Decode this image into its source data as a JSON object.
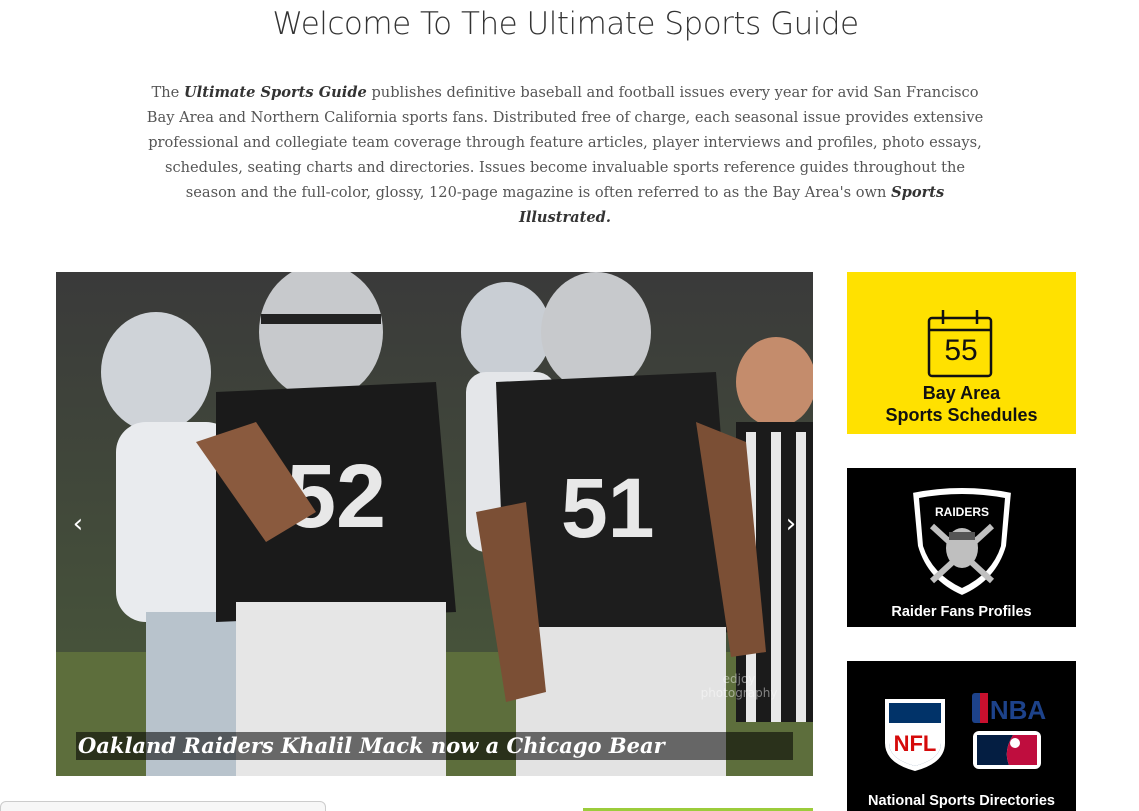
{
  "page": {
    "title": "Welcome To The Ultimate Sports Guide",
    "intro": {
      "before": "The ",
      "brand": "Ultimate Sports Guide",
      "middle": " publishes definitive baseball and football issues every year for avid San Francisco Bay Area and Northern California sports fans. Distributed free of charge, each seasonal issue provides extensive professional and collegiate team coverage through feature articles, player interviews and profiles, photo essays, schedules, seating charts and directories. Issues become invaluable sports reference guides throughout the season and the full-color, glossy, 120-page magazine is often referred to as the Bay Area's own ",
      "magazine": "Sports Illustrated."
    }
  },
  "slider": {
    "caption": "Oakland Raiders Khalil Mack now a Chicago Bear",
    "prev_icon": "‹",
    "next_icon": "›",
    "watermark": "edjoy photography",
    "jersey_left": "52",
    "jersey_right": "51"
  },
  "sidebar": {
    "schedules": {
      "number": "55",
      "line1": "Bay Area",
      "line2": "Sports Schedules",
      "bg": "#ffe100"
    },
    "raiders": {
      "logo_text": "RAIDERS",
      "label": "Raider Fans Profiles",
      "bg": "#000000"
    },
    "national": {
      "nfl": "NFL",
      "nba": "NBA",
      "label": "National Sports Directories",
      "bg": "#000000"
    }
  }
}
